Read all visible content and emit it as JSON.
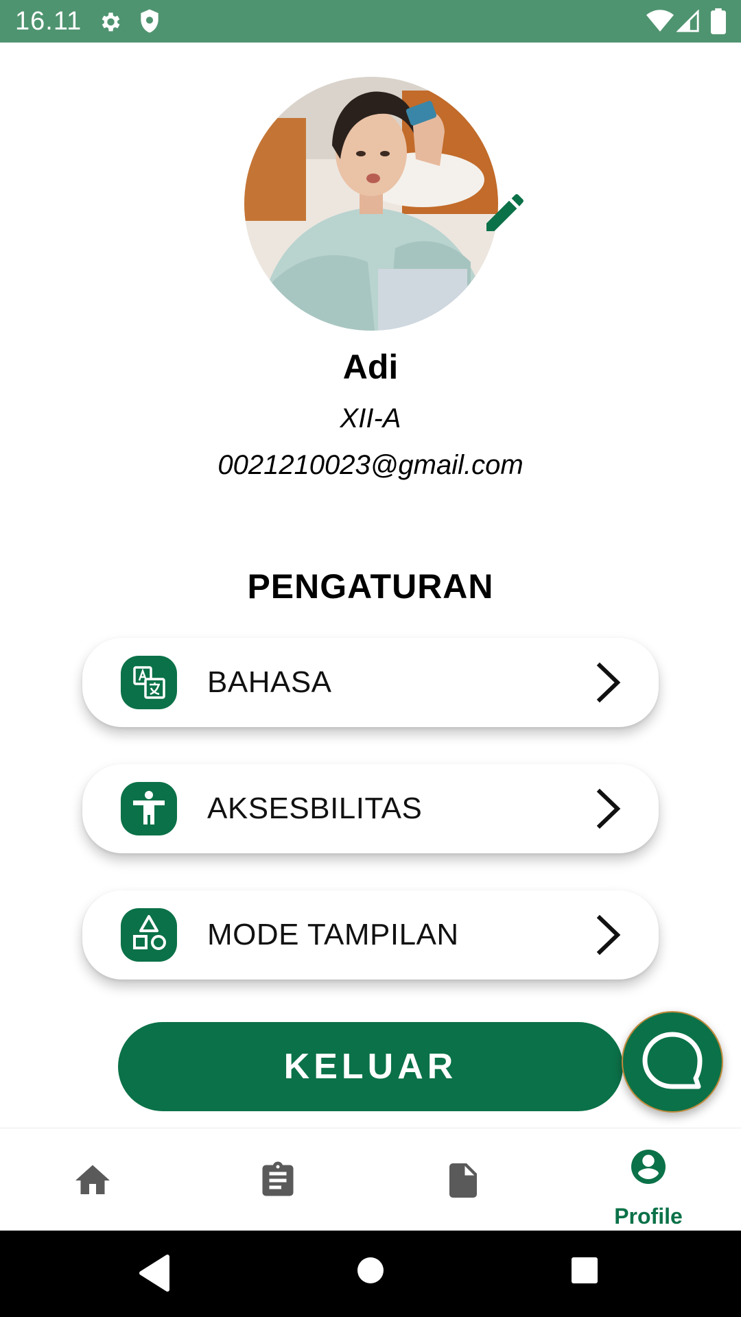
{
  "status_bar": {
    "time": "16.11",
    "icons": [
      "gear-icon",
      "shield-icon",
      "wifi-icon",
      "signal-icon",
      "battery-icon"
    ]
  },
  "profile": {
    "name": "Adi",
    "class": "XII-A",
    "email": "0021210023@gmail.com"
  },
  "settings": {
    "title": "PENGATURAN",
    "items": [
      {
        "label": "BAHASA",
        "icon": "translate-icon"
      },
      {
        "label": "AKSESBILITAS",
        "icon": "accessibility-icon"
      },
      {
        "label": "MODE TAMPILAN",
        "icon": "shapes-icon"
      }
    ]
  },
  "logout_label": "KELUAR",
  "bottom_nav": {
    "items": [
      {
        "name": "home",
        "icon": "home-icon",
        "label": ""
      },
      {
        "name": "tasks",
        "icon": "clipboard-icon",
        "label": ""
      },
      {
        "name": "documents",
        "icon": "document-icon",
        "label": ""
      },
      {
        "name": "profile",
        "icon": "account-icon",
        "label": "Profile",
        "active": true
      }
    ]
  },
  "colors": {
    "primary": "#0b7148",
    "status_bar": "#4f9470",
    "nav_inactive": "#5a5a5a"
  }
}
